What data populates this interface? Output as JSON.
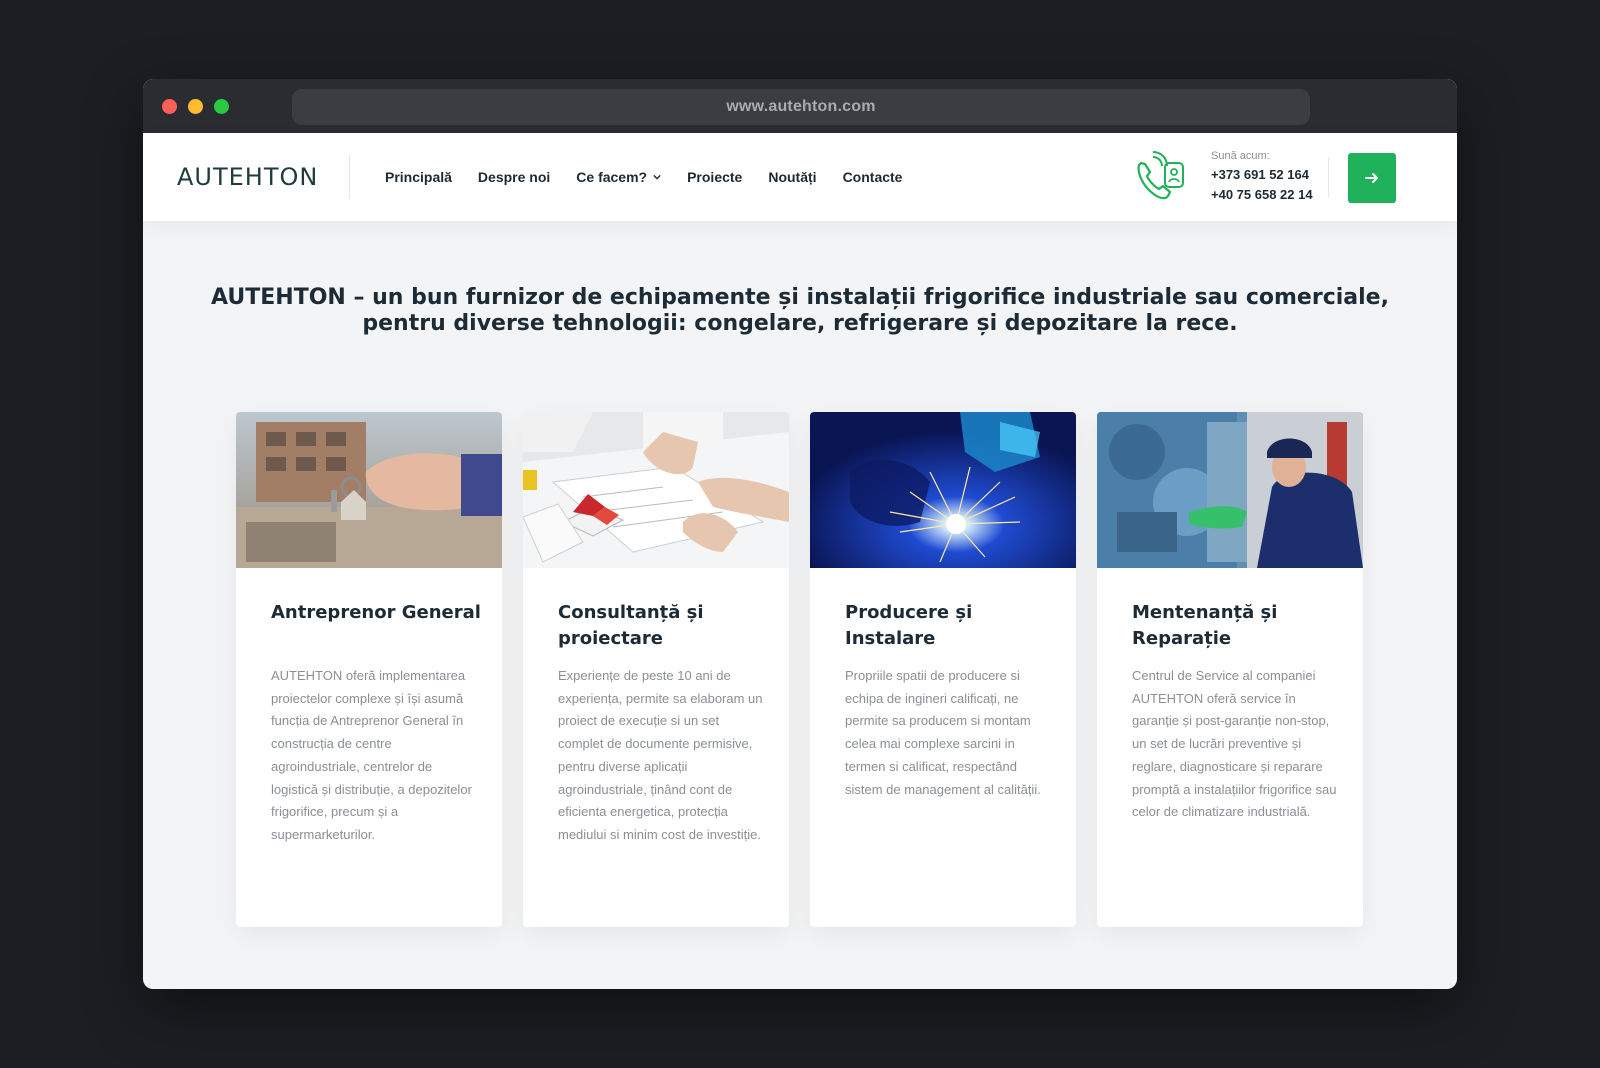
{
  "browser": {
    "url": "www.autehton.com"
  },
  "header": {
    "logo": "AUTEHTON",
    "nav": [
      {
        "label": "Principală"
      },
      {
        "label": "Despre noi"
      },
      {
        "label": "Ce facem?",
        "has_dropdown": true
      },
      {
        "label": "Proiecte"
      },
      {
        "label": "Noutăți"
      },
      {
        "label": "Contacte"
      }
    ],
    "call_label": "Sună acum:",
    "phone_1": "+373 691 52 164",
    "phone_2": "+40 75 658 22 14",
    "icons": {
      "phone": "phone-call-icon",
      "cta": "arrow-right-icon"
    }
  },
  "hero": {
    "title_line1": "AUTEHTON – un bun furnizor de echipamente și instalații frigorifice industriale sau comerciale,",
    "title_line2": "pentru diverse tehnologii: congelare, refrigerare și depozitare la rece."
  },
  "cards": [
    {
      "title": "Antreprenor General",
      "text": "AUTEHTON oferă implementarea proiectelor complexe și își asumă funcția de Antreprenor General în construcția de centre agroindustriale, centrelor de logistică și distribuție, a depozitelor frigorifice, precum și a supermarketurilor."
    },
    {
      "title": "Consultanță și proiectare",
      "text": "Experiențe de peste 10 ani de experiența, permite sa elaboram un proiect de execuție si un set complet de documente permisive, pentru diverse aplicații agroindustriale, ținând cont de eficienta energetica, protecția mediului si minim cost de investiție."
    },
    {
      "title": "Producere și Instalare",
      "text": "Propriile spatii de producere si echipa de ingineri calificați, ne permite sa producem si montam celea mai complexe sarcini in termen si calificat, respectând sistem de management al calității."
    },
    {
      "title": "Mentenanță și Reparație",
      "text": "Centrul de Service al companiei AUTEHTON oferă service în garanție și post-garanție non-stop, un set de lucrări preventive și reglare, diagnosticare și reparare promptă a instalațiilor frigorifice sau celor de climatizare industrială."
    }
  ],
  "colors": {
    "brand_green": "#1fb25a",
    "dark_text": "#1d2b36",
    "muted_text": "#8a8f95"
  }
}
